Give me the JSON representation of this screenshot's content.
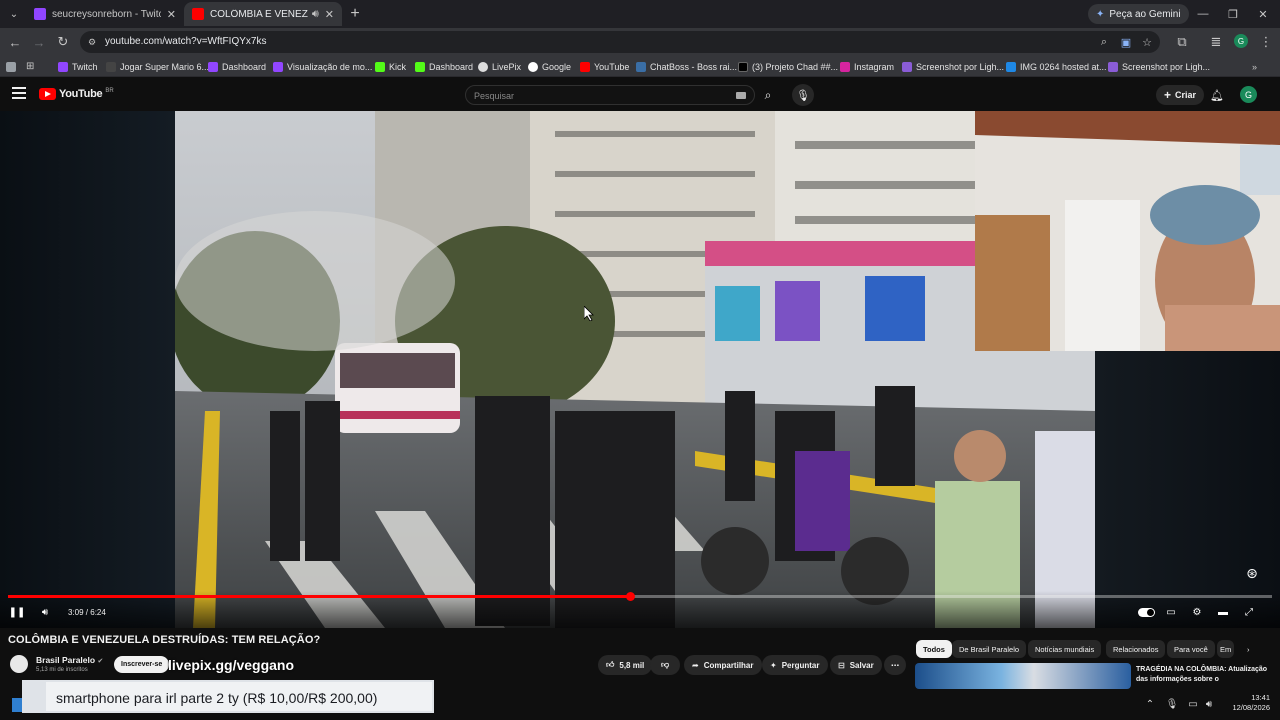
{
  "browser": {
    "tabs": [
      {
        "title": "seucreysonreborn - Twitch",
        "active": false,
        "favicon_color": "#9146ff"
      },
      {
        "title": "COLÔMBIA E VENEZUELA D",
        "active": true,
        "favicon_color": "#ff0000"
      }
    ],
    "gemini_label": "Peça ao Gemini",
    "url": "youtube.com/watch?v=WftFIQYx7ks",
    "profile_initial": "G",
    "bookmarks": [
      {
        "label": "Twitch",
        "color": "#9146ff"
      },
      {
        "label": "Jogar Super Mario 6...",
        "color": "#333333"
      },
      {
        "label": "Dashboard",
        "color": "#9146ff"
      },
      {
        "label": "Visualização de mo...",
        "color": "#9146ff"
      },
      {
        "label": "Kick",
        "color": "#53fc18"
      },
      {
        "label": "Dashboard",
        "color": "#53fc18"
      },
      {
        "label": "LivePix",
        "color": "#eeeeee"
      },
      {
        "label": "Google",
        "color": "#ffffff"
      },
      {
        "label": "YouTube",
        "color": "#ff0000"
      },
      {
        "label": "ChatBoss - Boss rai...",
        "color": "#3a6ea5"
      },
      {
        "label": "(3) Projeto Chad ##...",
        "color": "#000000"
      },
      {
        "label": "Instagram",
        "color": "#d6249f"
      },
      {
        "label": "Screenshot por Ligh...",
        "color": "#8a5cd6"
      },
      {
        "label": "IMG 0264 hosted at...",
        "color": "#1e88e5"
      },
      {
        "label": "Screenshot por Ligh...",
        "color": "#8a5cd6"
      }
    ]
  },
  "youtube": {
    "logo_text": "YouTube",
    "logo_country": "BR",
    "search_placeholder": "Pesquisar",
    "create_label": "Criar",
    "avatar_initial": "G"
  },
  "player": {
    "time_current": "3:09",
    "time_total": "6:24",
    "time_display": "3:09 / 6:24",
    "progress_fraction": 0.492,
    "state": "playing"
  },
  "video": {
    "title": "COLÔMBIA E VENEZUELA DESTRUÍDAS: TEM RELAÇÃO?",
    "channel": "Brasil Paralelo",
    "subscribers": "5,13 mi de inscritos",
    "subscribe_label": "Inscrever-se",
    "overlay_url": "livepix.gg/veggano",
    "likes": "5,8 mil",
    "share_label": "Compartilhar",
    "ask_label": "Perguntar",
    "save_label": "Salvar"
  },
  "related": {
    "chips": [
      "Todos",
      "De Brasil Paralelo",
      "Notícias mundiais",
      "Relacionados",
      "Para você",
      "Em"
    ],
    "first_title": "TRAGÉDIA NA COLÔMBIA: Atualização das informações sobre o"
  },
  "stream_overlay": {
    "donation_text": "smartphone para irl parte 2 ty (R$ 10,00/R$ 200,00)"
  },
  "taskbar": {
    "time": "13:41",
    "date": "12/08/2026"
  }
}
